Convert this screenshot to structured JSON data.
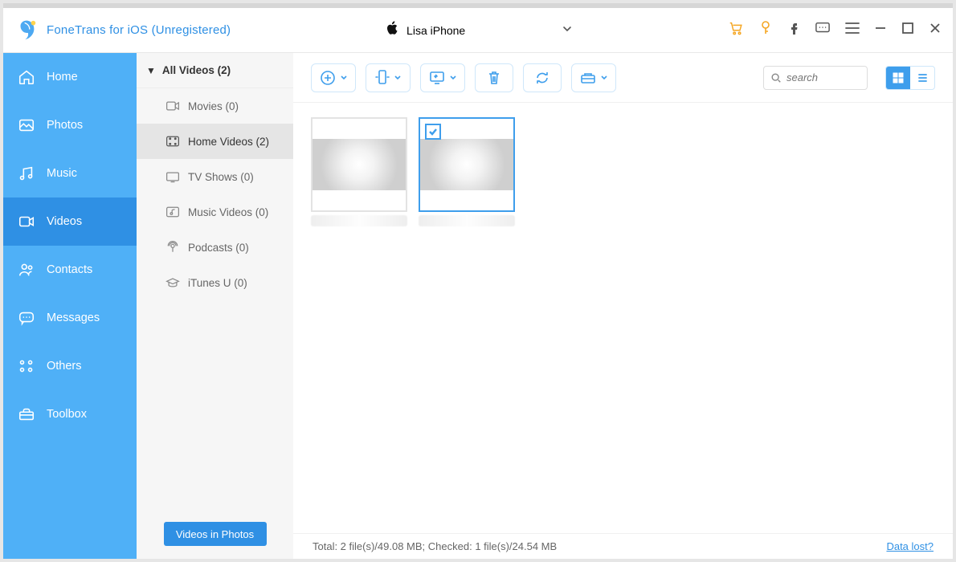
{
  "app": {
    "title": "FoneTrans for iOS (Unregistered)"
  },
  "device": {
    "name": "Lisa iPhone"
  },
  "sidebar": {
    "items": [
      {
        "label": "Home"
      },
      {
        "label": "Photos"
      },
      {
        "label": "Music"
      },
      {
        "label": "Videos"
      },
      {
        "label": "Contacts"
      },
      {
        "label": "Messages"
      },
      {
        "label": "Others"
      },
      {
        "label": "Toolbox"
      }
    ],
    "active_index": 3
  },
  "categories": {
    "header": "All Videos (2)",
    "items": [
      {
        "label": "Movies (0)"
      },
      {
        "label": "Home Videos (2)"
      },
      {
        "label": "TV Shows (0)"
      },
      {
        "label": "Music Videos (0)"
      },
      {
        "label": "Podcasts (0)"
      },
      {
        "label": "iTunes U (0)"
      }
    ],
    "active_index": 1,
    "footer_button": "Videos in Photos"
  },
  "search": {
    "placeholder": "search"
  },
  "status": {
    "text": "Total: 2 file(s)/49.08 MB; Checked: 1 file(s)/24.54 MB",
    "data_lost": "Data lost?"
  },
  "thumbnails": [
    {
      "selected": false
    },
    {
      "selected": true
    }
  ]
}
